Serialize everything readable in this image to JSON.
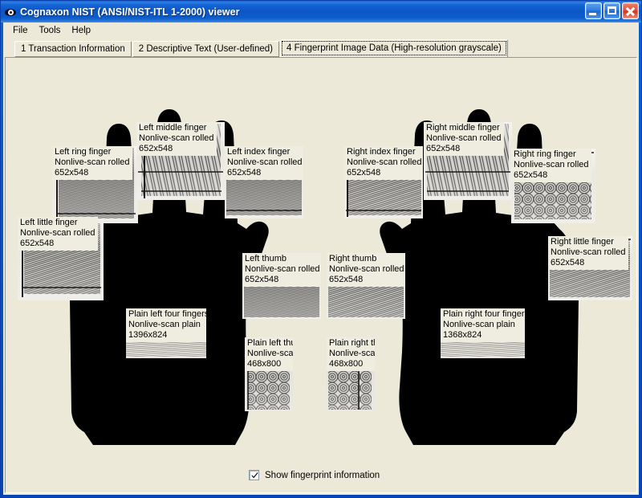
{
  "window": {
    "title": "Cognaxon NIST (ANSI/NIST-ITL 1-2000) viewer",
    "icon": "eye-icon",
    "controls": {
      "minimize": "Minimize",
      "maximize": "Maximize",
      "close": "Close"
    }
  },
  "menubar": {
    "items": [
      {
        "label": "File"
      },
      {
        "label": "Tools"
      },
      {
        "label": "Help"
      }
    ]
  },
  "tabs": [
    {
      "label": "1 Transaction Information",
      "active": false
    },
    {
      "label": "2 Descriptive Text (User-defined)",
      "active": false
    },
    {
      "label": "4 Fingerprint Image Data (High-resolution grayscale)",
      "active": true
    }
  ],
  "fingerprints": [
    {
      "id": "left-little-finger",
      "title": "Left little finger",
      "impression": "Nonlive-scan rolled",
      "size": "652x548"
    },
    {
      "id": "left-ring-finger",
      "title": "Left ring finger",
      "impression": "Nonlive-scan rolled",
      "size": "652x548"
    },
    {
      "id": "left-middle-finger",
      "title": "Left middle finger",
      "impression": "Nonlive-scan rolled",
      "size": "652x548"
    },
    {
      "id": "left-index-finger",
      "title": "Left index finger",
      "impression": "Nonlive-scan rolled",
      "size": "652x548"
    },
    {
      "id": "left-thumb",
      "title": "Left thumb",
      "impression": "Nonlive-scan rolled",
      "size": "652x548"
    },
    {
      "id": "right-thumb",
      "title": "Right thumb",
      "impression": "Nonlive-scan rolled",
      "size": "652x548"
    },
    {
      "id": "right-index-finger",
      "title": "Right index finger",
      "impression": "Nonlive-scan rolled",
      "size": "652x548"
    },
    {
      "id": "right-middle-finger",
      "title": "Right middle finger",
      "impression": "Nonlive-scan rolled",
      "size": "652x548"
    },
    {
      "id": "right-ring-finger",
      "title": "Right ring finger",
      "impression": "Nonlive-scan rolled",
      "size": "652x548"
    },
    {
      "id": "right-little-finger",
      "title": "Right little finger",
      "impression": "Nonlive-scan rolled",
      "size": "652x548"
    },
    {
      "id": "plain-left-four",
      "title": "Plain left four fingers",
      "impression": "Nonlive-scan plain",
      "size": "1396x824"
    },
    {
      "id": "plain-right-four",
      "title": "Plain right four fingers",
      "impression": "Nonlive-scan plain",
      "size": "1368x824"
    },
    {
      "id": "plain-left-thumb",
      "title": "Plain left thumb",
      "impression": "Nonlive-scan plain",
      "size": "468x800"
    },
    {
      "id": "plain-right-thumb",
      "title": "Plain right thumb",
      "impression": "Nonlive-scan plain",
      "size": "468x800"
    }
  ],
  "options": {
    "show_fingerprint_information": {
      "label": "Show fingerprint information",
      "checked": true
    }
  },
  "colors": {
    "title_bar": "#0a52c8",
    "window_border": "#0b3ea8",
    "client_background": "#ece9d8",
    "label_background": "#efeddf",
    "hand_silhouette": "#000000",
    "close_button": "#cc3a20"
  }
}
